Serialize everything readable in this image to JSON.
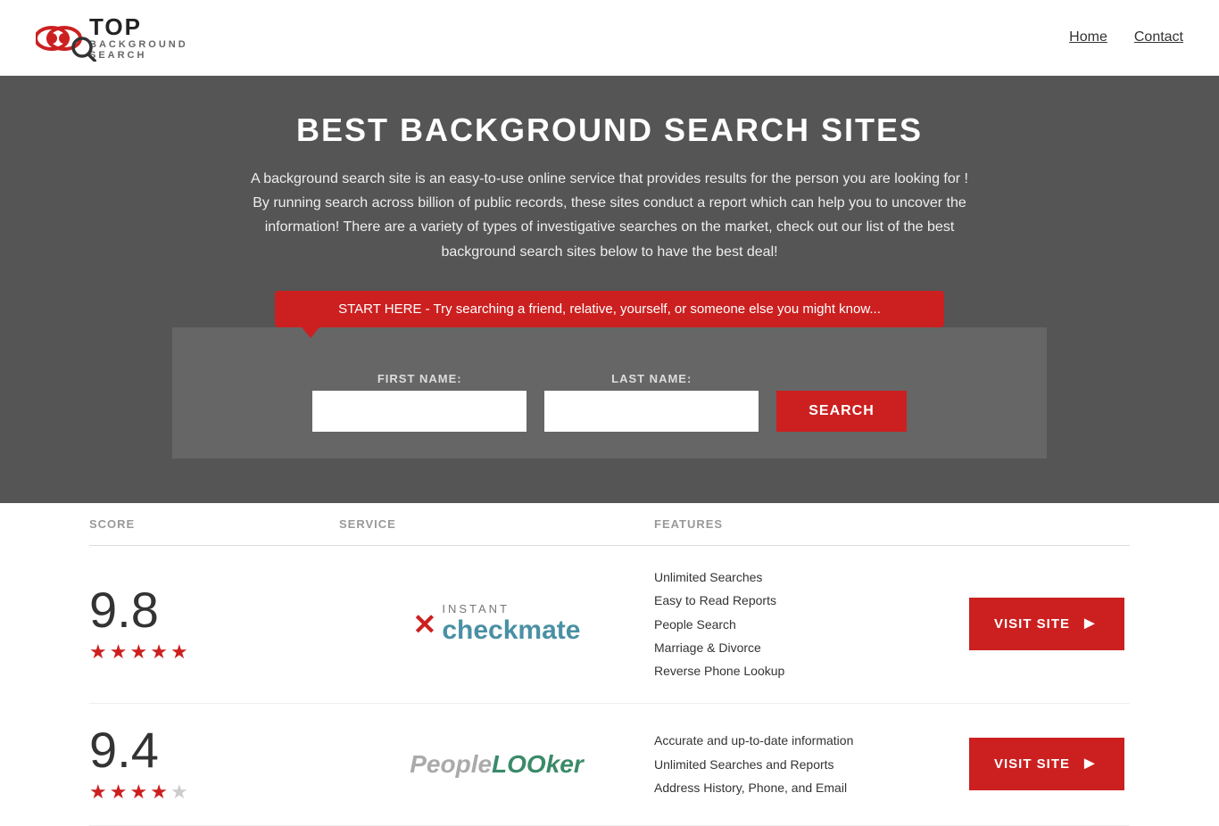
{
  "header": {
    "logo_top": "TOP",
    "logo_sub": "BACKGROUND\nSEARCH",
    "nav": [
      {
        "label": "Home",
        "href": "#"
      },
      {
        "label": "Contact",
        "href": "#"
      }
    ]
  },
  "hero": {
    "title": "BEST BACKGROUND SEARCH SITES",
    "description": "A background search site is an easy-to-use online service that provides results  for the person you are looking for ! By  running  search across billion of public records, these sites conduct  a report which can help you to uncover the information! There are a variety of types of investigative searches on the market, check out our  list of the best background search sites below to have the best deal!",
    "speech_bubble": "START HERE - Try searching a friend, relative, yourself, or someone else you might know...",
    "form": {
      "first_name_label": "FIRST NAME:",
      "last_name_label": "LAST NAME:",
      "search_button": "SEARCH"
    }
  },
  "table": {
    "headers": {
      "score": "SCORE",
      "service": "SERVICE",
      "features": "FEATURES",
      "action": ""
    },
    "rows": [
      {
        "score": "9.8",
        "stars": 5,
        "service_name": "Instant Checkmate",
        "features": [
          "Unlimited Searches",
          "Easy to Read Reports",
          "People Search",
          "Marriage & Divorce",
          "Reverse Phone Lookup"
        ],
        "visit_label": "VISIT SITE"
      },
      {
        "score": "9.4",
        "stars": 4,
        "service_name": "PeopleLooker",
        "features": [
          "Accurate and up-to-date information",
          "Unlimited Searches and Reports",
          "Address History, Phone, and Email"
        ],
        "visit_label": "VISIT SITE"
      }
    ]
  }
}
